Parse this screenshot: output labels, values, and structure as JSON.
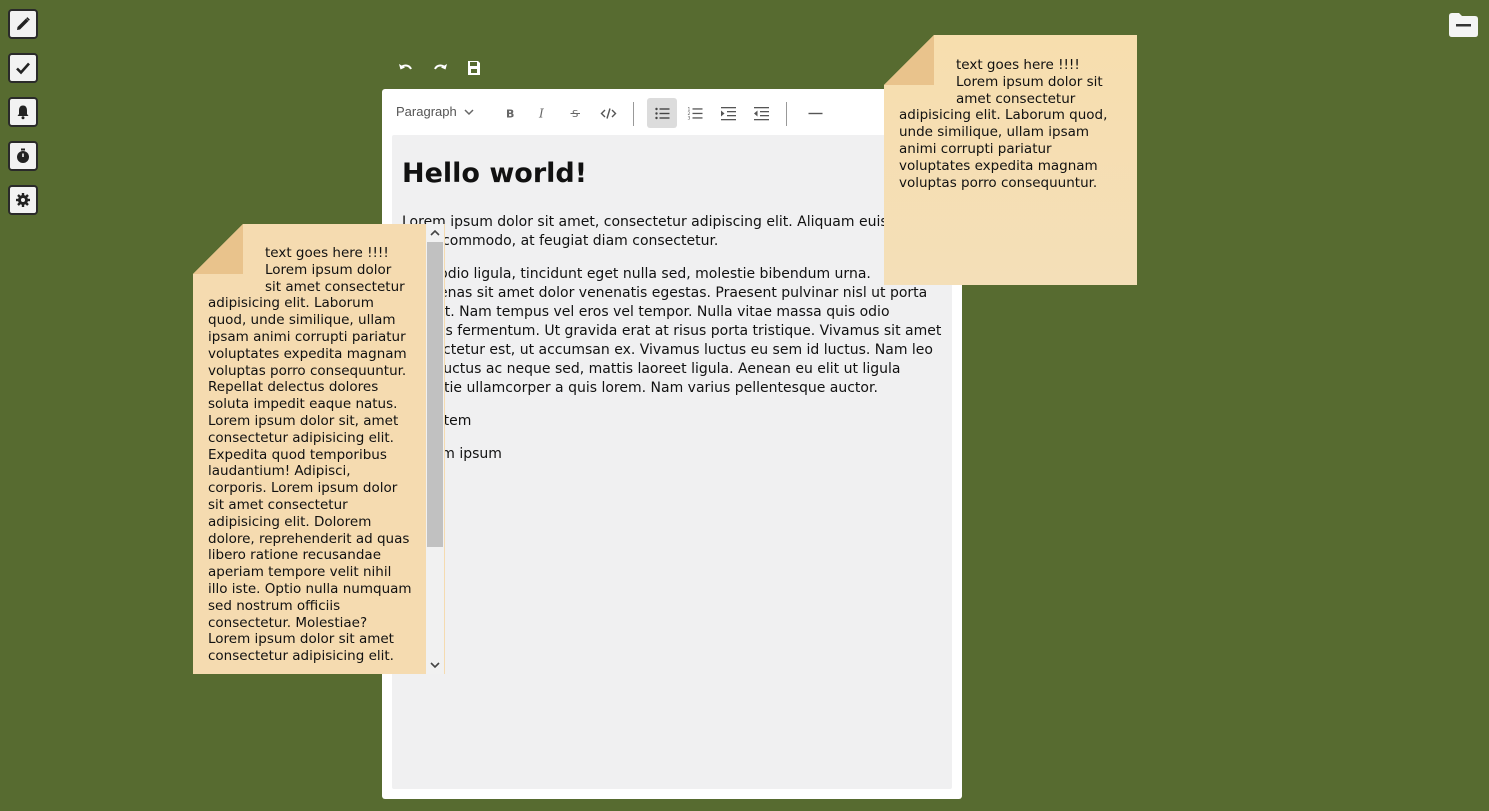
{
  "sidebar": {
    "items": [
      {
        "name": "pencil-icon"
      },
      {
        "name": "check-icon"
      },
      {
        "name": "bell-icon"
      },
      {
        "name": "timer-icon"
      },
      {
        "name": "gear-icon"
      }
    ]
  },
  "top_actions": {
    "icons": [
      "undo-icon",
      "redo-icon",
      "save-icon"
    ]
  },
  "toolbar": {
    "paragraph_select": "Paragraph",
    "buttons": [
      "bold",
      "italic",
      "strikethrough",
      "code",
      "bullet-list",
      "numbered-list",
      "indent",
      "outdent",
      "horizontal-rule"
    ],
    "active": "bullet-list"
  },
  "document": {
    "heading": "Hello world!",
    "paragraph1": "Lorem ipsum dolor sit amet, consectetur adipiscing elit. Aliquam euismod dolor commodo, at feugiat diam consectetur.",
    "paragraph2": "Nam odio ligula, tincidunt eget nulla sed, molestie bibendum urna. Maecenas sit amet dolor venenatis egestas. Praesent pulvinar nisl ut porta aliquet. Nam tempus vel eros vel tempor. Nulla vitae massa quis odio sagittis fermentum. Ut gravida erat at risus porta tristique. Vivamus sit amet consectetur est, ut accumsan ex. Vivamus luctus eu sem id luctus. Nam leo erat, luctus ac neque sed, mattis laoreet ligula. Aenean eu elit ut ligula molestie ullamcorper a quis lorem. Nam varius pellentesque auctor.",
    "list_item1": "list item",
    "list_item2": "lorem ipsum"
  },
  "note1": {
    "line1": "text goes here !!!!",
    "line2": "Lorem ipsum dolor sit",
    "line3": "amet consectetur",
    "rest": "adipisicing elit. Laborum quod, unde similique, ullam ipsam animi corrupti pariatur voluptates expedita magnam voluptas porro consequuntur."
  },
  "note2": {
    "line1": "text goes here !!!!",
    "line2": "Lorem ipsum dolor",
    "line3": "sit amet consectetur",
    "rest": "adipisicing elit. Laborum quod, unde similique, ullam ipsam animi corrupti pariatur voluptates expedita magnam voluptas porro consequuntur. Repellat delectus dolores soluta impedit eaque natus. Lorem ipsum dolor sit, amet consectetur adipisicing elit. Expedita quod temporibus laudantium! Adipisci, corporis. Lorem ipsum dolor sit amet consectetur adipisicing elit. Dolorem dolore, reprehenderit ad quas libero ratione recusandae aperiam tempore velit nihil illo iste. Optio nulla numquam sed nostrum officiis consectetur. Molestiae? Lorem ipsum dolor sit amet consectetur adipisicing elit."
  },
  "colors": {
    "background": "#576b30",
    "note": "#f5ddb1",
    "note_fold": "#e9c38c",
    "editor_bg": "#f0f0f1"
  }
}
